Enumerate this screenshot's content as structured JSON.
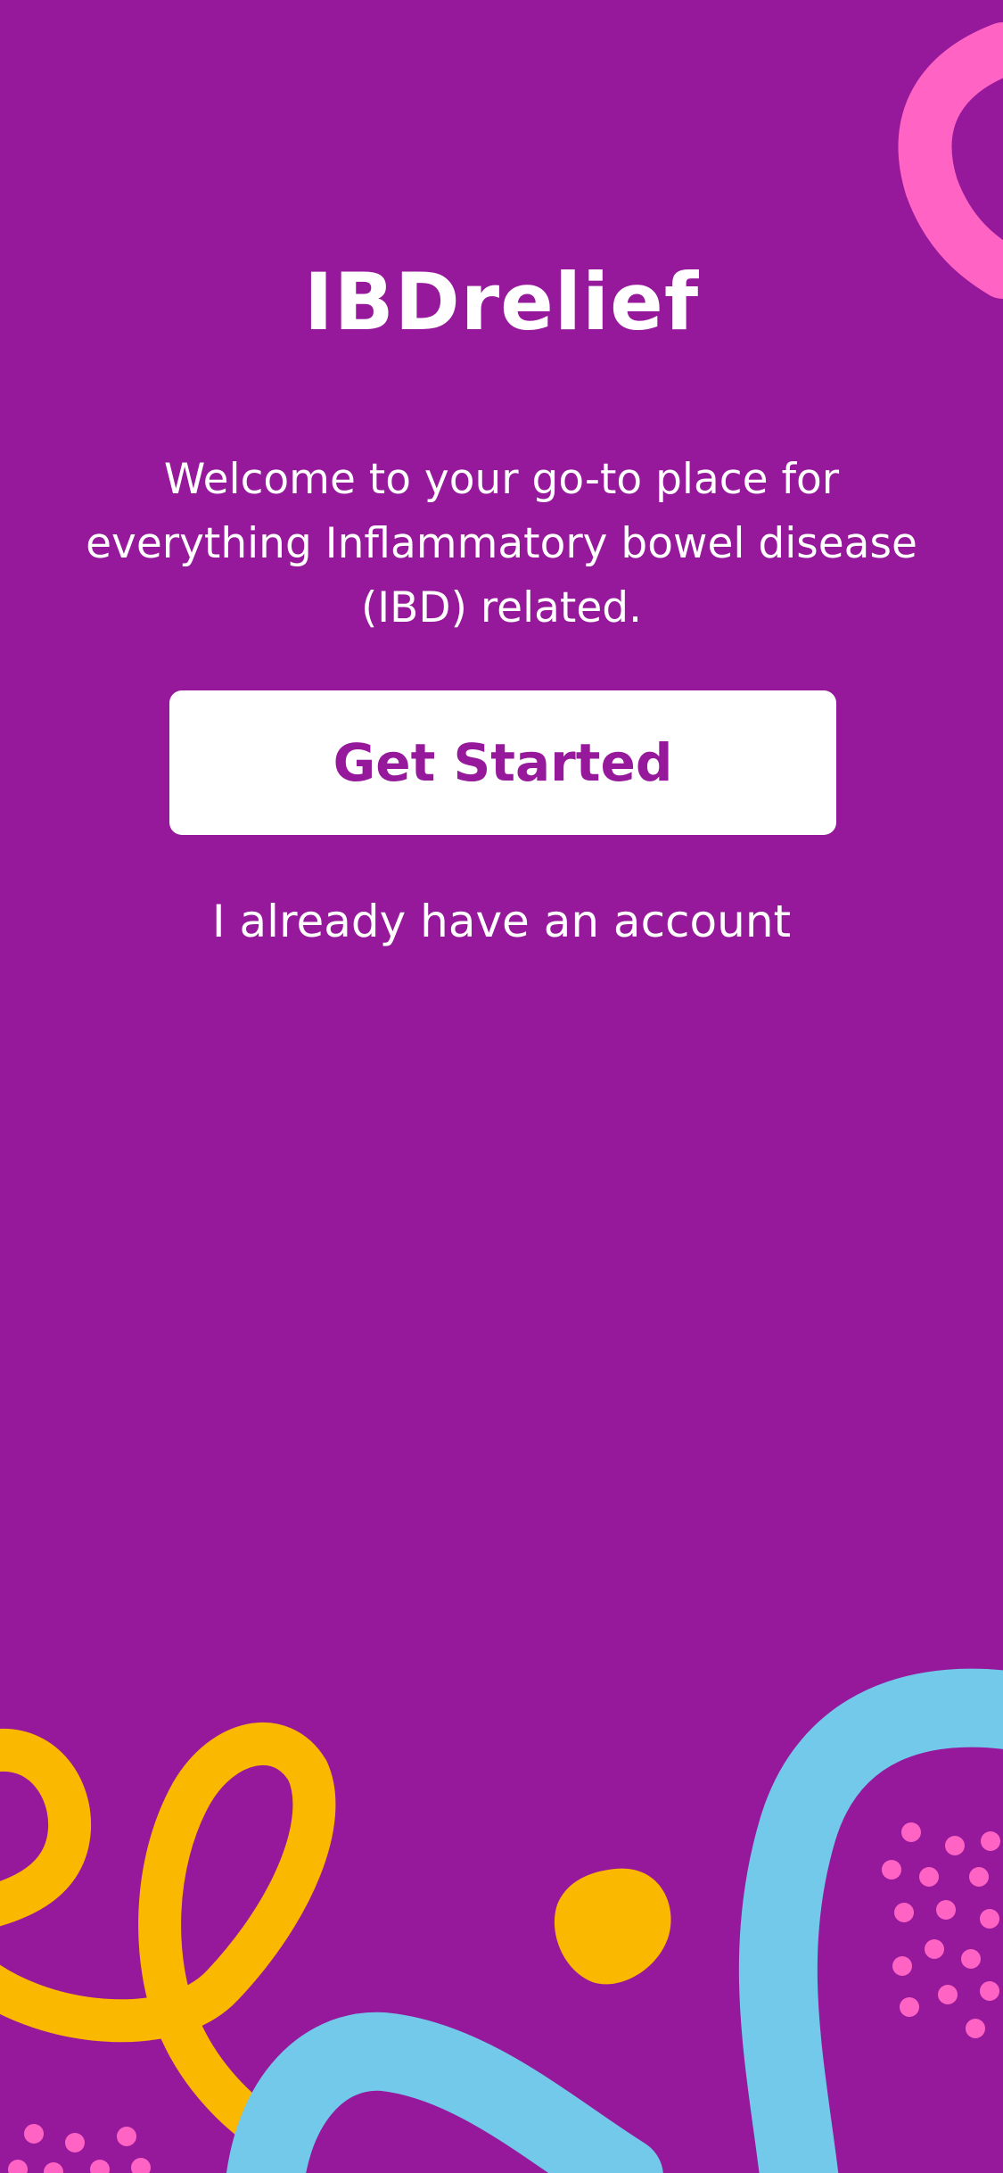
{
  "app": {
    "title": "IBDrelief",
    "welcome_text": "Welcome to your go-to place for everything Inflammatory bowel disease (IBD) related."
  },
  "actions": {
    "primary_label": "Get Started",
    "secondary_label": "I already have an account"
  },
  "colors": {
    "background": "#96189b",
    "button_background": "#ffffff",
    "button_text": "#96189b",
    "accent_pink": "#ff63c4",
    "accent_yellow": "#fbb800",
    "accent_blue": "#72c9ea"
  }
}
